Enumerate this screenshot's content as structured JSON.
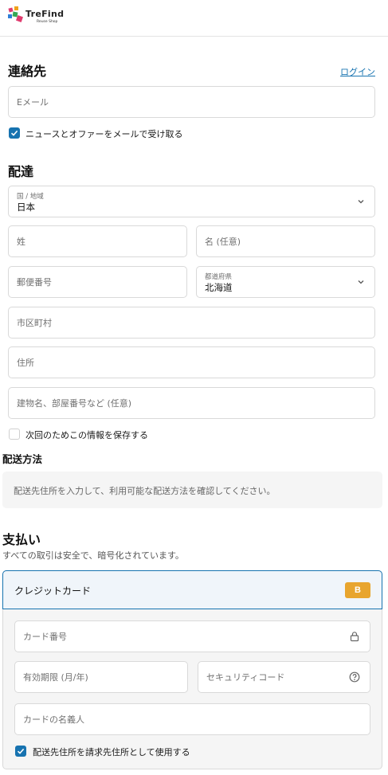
{
  "brand": {
    "name": "TreFind",
    "tagline": "Reuse Shop"
  },
  "contact": {
    "title": "連絡先",
    "login_link": "ログイン",
    "email_placeholder": "Eメール",
    "newsletter_label": "ニュースとオファーをメールで受け取る",
    "newsletter_checked": true
  },
  "delivery": {
    "title": "配達",
    "country_label": "国 / 地域",
    "country_value": "日本",
    "last_name_placeholder": "姓",
    "first_name_placeholder": "名 (任意)",
    "postal_placeholder": "郵便番号",
    "prefecture_label": "都道府県",
    "prefecture_value": "北海道",
    "city_placeholder": "市区町村",
    "address_placeholder": "住所",
    "building_placeholder": "建物名、部屋番号など (任意)",
    "save_info_label": "次回のためこの情報を保存する",
    "save_info_checked": false
  },
  "shipping": {
    "title": "配送方法",
    "notice": "配送先住所を入力して、利用可能な配送方法を確認してください。"
  },
  "payment": {
    "title": "支払い",
    "description": "すべての取引は安全で、暗号化されています。",
    "method_label": "クレジットカード",
    "badge": "B",
    "card_number_placeholder": "カード番号",
    "expiry_placeholder": "有効期限 (月/年)",
    "cvc_placeholder": "セキュリティコード",
    "name_placeholder": "カードの名義人",
    "billing_same_label": "配送先住所を請求先住所として使用する",
    "billing_same_checked": true
  },
  "colors": {
    "accent": "#1773b0",
    "badge": "#e8a52e",
    "border": "#d9d9d9"
  }
}
